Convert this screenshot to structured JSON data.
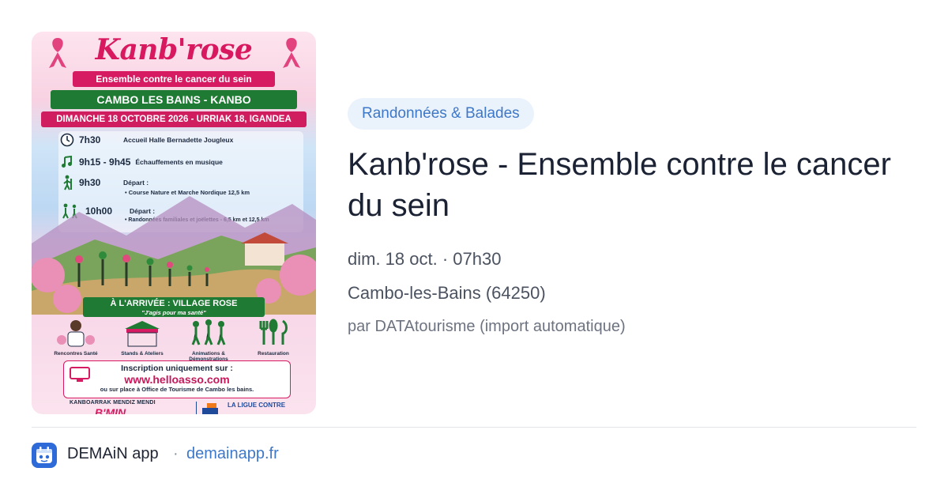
{
  "poster": {
    "logo": "Kanb'rose",
    "tagline": "Ensemble contre le cancer du sein",
    "location_band": "CAMBO LES BAINS - KANBO",
    "date_band": "DIMANCHE 18 OCTOBRE 2026 - URRIAK 18, IGANDEA",
    "schedule": [
      {
        "time": "7h30",
        "text": "Accueil Halle Bernadette Jougleux",
        "icon": "clock-icon"
      },
      {
        "time": "9h15 - 9h45",
        "text": "Échauffements en musique",
        "icon": "music-note-icon"
      },
      {
        "time": "9h30",
        "text": "Départ :",
        "sub": "• Course Nature et Marche Nordique 12,5 km",
        "icon": "hiker-icon"
      },
      {
        "time": "10h00",
        "text": "Départ :",
        "sub": "• Randonnées familiales et joëlettes - 6,5 km et 12,5 km",
        "icon": "family-hikers-icon"
      }
    ],
    "arrival_title": "À L'ARRIVÉE : VILLAGE ROSE",
    "arrival_subtitle": "\"J'agis pour ma santé\"",
    "activities": [
      "Rencontres Santé",
      "Stands & Ateliers",
      "Animations & Démonstrations",
      "Restauration"
    ],
    "signup_line1": "Inscription uniquement sur :",
    "signup_url": "www.helloasso.com",
    "signup_line3": "ou sur place à Office de Tourisme de Cambo les bains.",
    "footer_left": "KANBOARRAK MENDIZ MENDI",
    "footer_left_logo": "B'MIN",
    "footer_right": "LA LIGUE CONTRE"
  },
  "category_badge": "Randonnées & Balades",
  "event_title": "Kanb'rose - Ensemble contre le cancer du sein",
  "date_time": "dim. 18 oct. · 07h30",
  "place": "Cambo-les-Bains (64250)",
  "source": "par DATAtourisme (import automatique)",
  "footer": {
    "app_name": "DEMAiN app",
    "separator": "·",
    "domain": "demainapp.fr"
  },
  "colors": {
    "brand_pink": "#d61b62",
    "brand_green": "#1f7a34",
    "badge_bg": "#eaf2fc",
    "link_blue": "#3e78c8"
  }
}
